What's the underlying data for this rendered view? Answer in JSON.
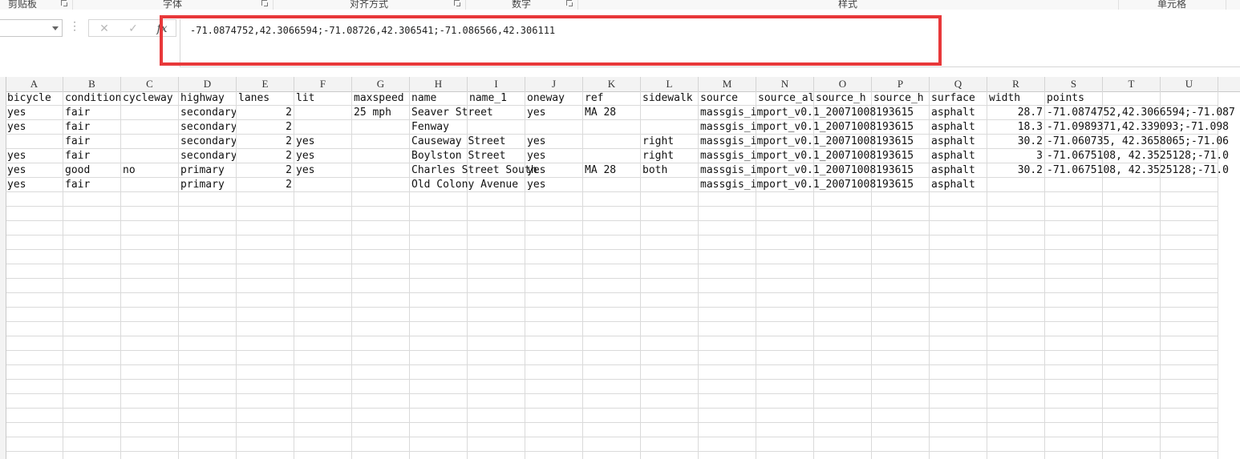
{
  "ribbon": {
    "groups": [
      {
        "label": "剪贴板"
      },
      {
        "label": "字体"
      },
      {
        "label": "对齐方式"
      },
      {
        "label": "数字"
      },
      {
        "label": "样式"
      },
      {
        "label": "单元格"
      }
    ]
  },
  "formula_bar": {
    "name_box": "",
    "cancel_icon": "✕",
    "enter_icon": "✓",
    "fx_icon": "fx",
    "content": "-71.0874752,42.3066594;-71.08726,42.306541;-71.086566,42.306111"
  },
  "columns": [
    "A",
    "B",
    "C",
    "D",
    "E",
    "F",
    "G",
    "H",
    "I",
    "J",
    "K",
    "L",
    "M",
    "N",
    "O",
    "P",
    "Q",
    "R",
    "S",
    "T",
    "U"
  ],
  "table": {
    "header": [
      "bicycle",
      "condition",
      "cycleway",
      "highway",
      "lanes",
      "lit",
      "maxspeed",
      "name",
      "name_1",
      "oneway",
      "ref",
      "sidewalk",
      "source",
      "source_al",
      "source_h",
      "source_h",
      "surface",
      "width",
      "points",
      "",
      ""
    ],
    "rows": [
      [
        "yes",
        "fair",
        "",
        "secondary",
        "2",
        "",
        "25 mph",
        "Seaver Street",
        "",
        "yes",
        "MA 28",
        "",
        "massgis_import_v0.1_20071008193615",
        "",
        "",
        "",
        "asphalt",
        "28.7",
        "-71.0874752,42.3066594;-71.087",
        "",
        ""
      ],
      [
        "yes",
        "fair",
        "",
        "secondary",
        "2",
        "",
        "",
        "Fenway",
        "",
        "",
        "",
        "",
        "massgis_import_v0.1_20071008193615",
        "",
        "",
        "",
        "asphalt",
        "18.3",
        " -71.0989371,42.339093;-71.098",
        "",
        ""
      ],
      [
        "",
        "fair",
        "",
        "secondary",
        "2",
        "yes",
        "",
        "Causeway Street",
        "",
        "yes",
        "",
        "right",
        "massgis_import_v0.1_20071008193615",
        "",
        "",
        "",
        "asphalt",
        "30.2",
        " -71.060735, 42.3658065;-71.06",
        "",
        ""
      ],
      [
        "yes",
        "fair",
        "",
        "secondary",
        "2",
        "yes",
        "",
        "Boylston Street",
        "",
        "yes",
        "",
        "right",
        "massgis_import_v0.1_20071008193615",
        "",
        "",
        "",
        "asphalt",
        "3",
        " -71.0675108, 42.3525128;-71.0",
        "",
        ""
      ],
      [
        "yes",
        "good",
        "no",
        "primary",
        "2",
        "yes",
        "",
        "Charles Street South",
        "",
        "yes",
        "MA 28",
        "both",
        "massgis_import_v0.1_20071008193615",
        "",
        "",
        "",
        "asphalt",
        "30.2",
        " -71.0675108, 42.3525128;-71.0",
        "",
        ""
      ],
      [
        "yes",
        "fair",
        "",
        "primary",
        "2",
        "",
        "",
        "Old Colony Avenue",
        "",
        "yes",
        "",
        "",
        "massgis_import_v0.1_20071008193615",
        "",
        "",
        "",
        "asphalt",
        "",
        "",
        "",
        ""
      ]
    ]
  },
  "colors": {
    "highlight": "#e8383a",
    "grid_line": "#dadada",
    "header_bg": "#f3f3f3"
  }
}
